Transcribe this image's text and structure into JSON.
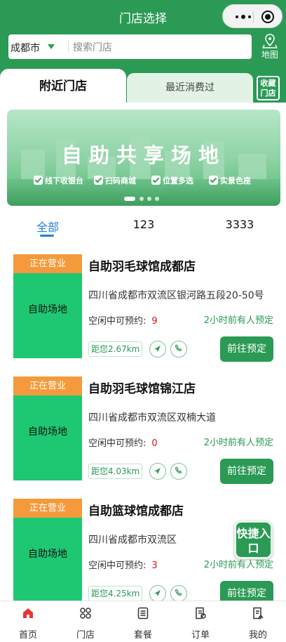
{
  "header": {
    "title": "门店选择",
    "city": "成都市",
    "search_placeholder": "搜索门店",
    "map_label": "地图"
  },
  "tabs": {
    "nearby": "附近门店",
    "recent": "最近消费过",
    "favorites": "收藏门店"
  },
  "banner": {
    "title": "自助共享场地",
    "features": [
      "线下收银台",
      "扫码商城",
      "位置多选",
      "实景色座"
    ]
  },
  "categories": [
    "全部",
    "123",
    "3333"
  ],
  "stores": [
    {
      "status": "正在营业",
      "thumb_label": "自助场地",
      "name": "自助羽毛球馆成都店",
      "address": "四川省成都市双流区银河路五段20-50号",
      "avail_label": "空闲中可预约:",
      "avail_count": "9",
      "recent": "2小时前有人预定",
      "distance": "距您2.67km",
      "button": "前往预定"
    },
    {
      "status": "正在营业",
      "thumb_label": "自助场地",
      "name": "自助羽毛球馆锦江店",
      "address": "四川省成都市双流区双楠大道",
      "avail_label": "空闲中可预约:",
      "avail_count": "0",
      "recent": "2小时前有人预定",
      "distance": "距您4.03km",
      "button": "前往预定"
    },
    {
      "status": "正在营业",
      "thumb_label": "自助场地",
      "name": "自助篮球馆成都店",
      "address": "四川省成都市双流区",
      "avail_label": "空闲中可预约:",
      "avail_count": "3",
      "recent": "2小时前有人预定",
      "distance": "距您4.25km",
      "button": "前往预定"
    }
  ],
  "quick_entry": "快捷入口",
  "tabbar": {
    "items": [
      {
        "label": "首页",
        "icon": "home-icon"
      },
      {
        "label": "门店",
        "icon": "store-icon"
      },
      {
        "label": "套餐",
        "icon": "package-icon"
      },
      {
        "label": "订单",
        "icon": "order-icon"
      },
      {
        "label": "我的",
        "icon": "profile-icon"
      }
    ]
  },
  "colors": {
    "primary": "#2a9a55",
    "accent_tab": "#1e7fe0",
    "badge": "#f59a3c",
    "thumb": "#1ec872"
  }
}
